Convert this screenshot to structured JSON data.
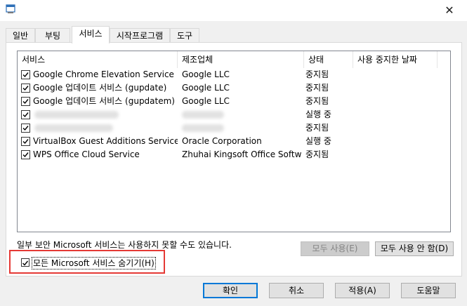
{
  "window": {
    "close_glyph": "✕",
    "icon": "msconfig-icon"
  },
  "tabs": [
    {
      "label": "일반"
    },
    {
      "label": "부팅"
    },
    {
      "label": "서비스",
      "active": true
    },
    {
      "label": "시작프로그램"
    },
    {
      "label": "도구"
    }
  ],
  "columns": {
    "service": "서비스",
    "manufacturer": "제조업체",
    "status": "상태",
    "disabled_date": "사용 중지한 날짜"
  },
  "services": [
    {
      "name": "Google Chrome Elevation Service",
      "manufacturer": "Google LLC",
      "status": "중지됨",
      "checked": true
    },
    {
      "name": "Google 업데이트 서비스 (gupdate)",
      "manufacturer": "Google LLC",
      "status": "중지됨",
      "checked": true
    },
    {
      "name": "Google 업데이트 서비스 (gupdatem)",
      "manufacturer": "Google LLC",
      "status": "중지됨",
      "checked": true
    },
    {
      "name": "",
      "manufacturer": "",
      "status": "실행 중",
      "checked": true,
      "redacted": true
    },
    {
      "name": "",
      "manufacturer": "",
      "status": "중지됨",
      "checked": true,
      "redacted": true
    },
    {
      "name": "VirtualBox Guest Additions Service",
      "manufacturer": "Oracle Corporation",
      "status": "실행 중",
      "checked": true
    },
    {
      "name": "WPS Office Cloud Service",
      "manufacturer": "Zhuhai Kingsoft Office Softw...",
      "status": "중지됨",
      "checked": true
    }
  ],
  "note": "일부 보안 Microsoft 서비스는 사용하지 못할 수도 있습니다.",
  "buttons": {
    "enable_all": "모두 사용(E)",
    "disable_all": "모두 사용 안 함(D)",
    "hide_ms": "모든 Microsoft 서비스 숨기기(H)",
    "hide_ms_checked": true,
    "ok": "확인",
    "cancel": "취소",
    "apply": "적용(A)",
    "help": "도움말"
  },
  "colors": {
    "highlight": "#e53935",
    "primary_border": "#0078d7"
  }
}
